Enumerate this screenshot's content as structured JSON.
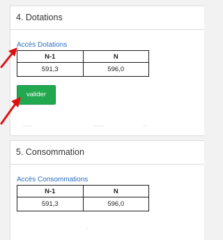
{
  "sections": [
    {
      "title": "4. Dotations",
      "link": "Accès Dotations",
      "columns": [
        "N-1",
        "N"
      ],
      "values": [
        "591,3",
        "596,0"
      ],
      "button": "valider"
    },
    {
      "title": "5. Consommation",
      "link": "Accès Consommations",
      "columns": [
        "N-1",
        "N"
      ],
      "values": [
        "591,3",
        "596,0"
      ]
    }
  ],
  "colors": {
    "accent_green": "#22a94f",
    "link_blue": "#2a6fbe",
    "annotation_red": "#e01010"
  },
  "annotations": [
    "red-arrow-icon",
    "red-arrow-icon"
  ]
}
